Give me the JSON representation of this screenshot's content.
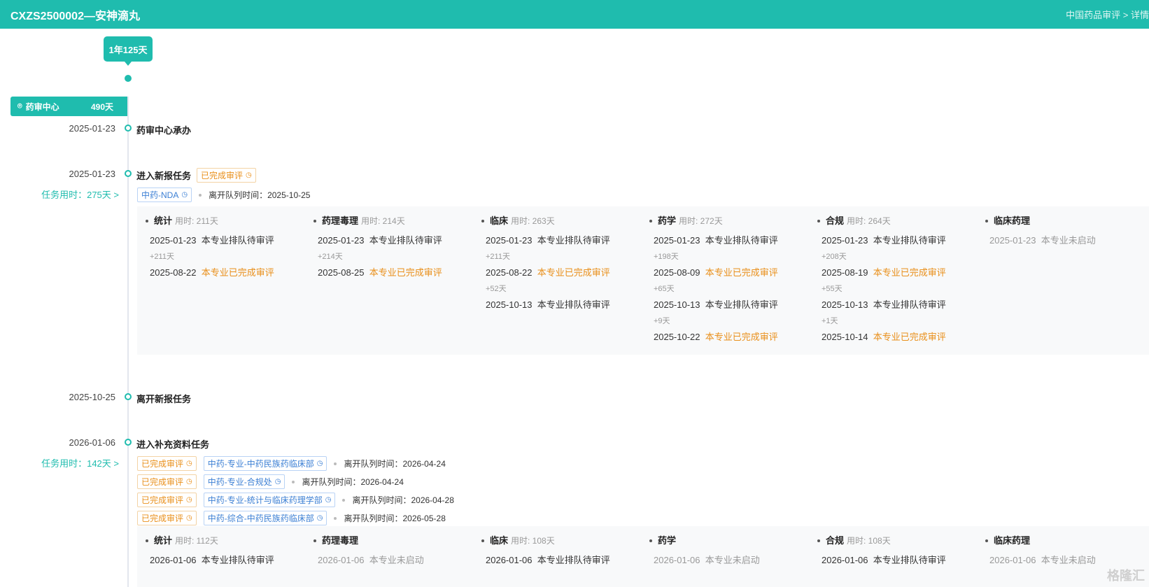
{
  "header": {
    "title": "CXZS2500002—安神滴丸",
    "crumb": "中国药品审评 > 详情"
  },
  "timeline": {
    "total": "1年125天",
    "center": {
      "name": "药审中心",
      "days": "490天"
    },
    "events": [
      {
        "date": "2025-01-23",
        "label": "药审中心承办"
      },
      {
        "date": "2025-01-23",
        "label": "进入新报任务",
        "status": "已完成审评",
        "usage": "任务用时：275天 >",
        "queue_tag": "中药-NDA",
        "leave_label": "离开队列时间：2025-10-25"
      },
      {
        "date": "2025-10-25",
        "label": "离开新报任务"
      },
      {
        "date": "2026-01-06",
        "label": "进入补充资料任务",
        "usage": "任务用时：142天 >",
        "rows": [
          {
            "status": "已完成审评",
            "queue": "中药-专业-中药民族药临床部",
            "leave": "离开队列时间：2026-04-24"
          },
          {
            "status": "已完成审评",
            "queue": "中药-专业-合规处",
            "leave": "离开队列时间：2026-04-24"
          },
          {
            "status": "已完成审评",
            "queue": "中药-专业-统计与临床药理学部",
            "leave": "离开队列时间：2026-04-28"
          },
          {
            "status": "已完成审评",
            "queue": "中药-综合-中药民族药临床部",
            "leave": "离开队列时间：2026-05-28"
          }
        ]
      }
    ]
  },
  "panel1": [
    {
      "name": "统计",
      "use": "用时: 211天",
      "entries": [
        {
          "t": "e",
          "date": "2025-01-23",
          "text": "本专业排队待审评"
        },
        {
          "t": "g",
          "text": "+211天"
        },
        {
          "t": "e",
          "date": "2025-08-22",
          "text": "本专业已完成审评",
          "done": true
        }
      ]
    },
    {
      "name": "药理毒理",
      "use": "用时: 214天",
      "entries": [
        {
          "t": "e",
          "date": "2025-01-23",
          "text": "本专业排队待审评"
        },
        {
          "t": "g",
          "text": "+214天"
        },
        {
          "t": "e",
          "date": "2025-08-25",
          "text": "本专业已完成审评",
          "done": true
        }
      ]
    },
    {
      "name": "临床",
      "use": "用时: 263天",
      "entries": [
        {
          "t": "e",
          "date": "2025-01-23",
          "text": "本专业排队待审评"
        },
        {
          "t": "g",
          "text": "+211天"
        },
        {
          "t": "e",
          "date": "2025-08-22",
          "text": "本专业已完成审评",
          "done": true
        },
        {
          "t": "g",
          "text": "+52天"
        },
        {
          "t": "e",
          "date": "2025-10-13",
          "text": "本专业排队待审评"
        }
      ]
    },
    {
      "name": "药学",
      "use": "用时: 272天",
      "entries": [
        {
          "t": "e",
          "date": "2025-01-23",
          "text": "本专业排队待审评"
        },
        {
          "t": "g",
          "text": "+198天"
        },
        {
          "t": "e",
          "date": "2025-08-09",
          "text": "本专业已完成审评",
          "done": true
        },
        {
          "t": "g",
          "text": "+65天"
        },
        {
          "t": "e",
          "date": "2025-10-13",
          "text": "本专业排队待审评"
        },
        {
          "t": "g",
          "text": "+9天"
        },
        {
          "t": "e",
          "date": "2025-10-22",
          "text": "本专业已完成审评",
          "done": true
        }
      ]
    },
    {
      "name": "合规",
      "use": "用时: 264天",
      "entries": [
        {
          "t": "e",
          "date": "2025-01-23",
          "text": "本专业排队待审评"
        },
        {
          "t": "g",
          "text": "+208天"
        },
        {
          "t": "e",
          "date": "2025-08-19",
          "text": "本专业已完成审评",
          "done": true
        },
        {
          "t": "g",
          "text": "+55天"
        },
        {
          "t": "e",
          "date": "2025-10-13",
          "text": "本专业排队待审评"
        },
        {
          "t": "g",
          "text": "+1天"
        },
        {
          "t": "e",
          "date": "2025-10-14",
          "text": "本专业已完成审评",
          "done": true
        }
      ]
    },
    {
      "name": "临床药理",
      "use": "",
      "entries": [
        {
          "t": "e",
          "date": "2025-01-23",
          "text": "本专业未启动",
          "grey": true
        }
      ]
    }
  ],
  "panel2": [
    {
      "name": "统计",
      "use": "用时: 112天",
      "entries": [
        {
          "t": "e",
          "date": "2026-01-06",
          "text": "本专业排队待审评"
        }
      ]
    },
    {
      "name": "药理毒理",
      "use": "",
      "entries": [
        {
          "t": "e",
          "date": "2026-01-06",
          "text": "本专业未启动",
          "grey": true
        }
      ]
    },
    {
      "name": "临床",
      "use": "用时: 108天",
      "entries": [
        {
          "t": "e",
          "date": "2026-01-06",
          "text": "本专业排队待审评"
        }
      ]
    },
    {
      "name": "药学",
      "use": "",
      "entries": [
        {
          "t": "e",
          "date": "2026-01-06",
          "text": "本专业未启动",
          "grey": true
        }
      ]
    },
    {
      "name": "合规",
      "use": "用时: 108天",
      "entries": [
        {
          "t": "e",
          "date": "2026-01-06",
          "text": "本专业排队待审评"
        }
      ]
    },
    {
      "name": "临床药理",
      "use": "",
      "entries": [
        {
          "t": "e",
          "date": "2026-01-06",
          "text": "本专业未启动",
          "grey": true
        }
      ]
    }
  ],
  "watermark": "格隆汇"
}
